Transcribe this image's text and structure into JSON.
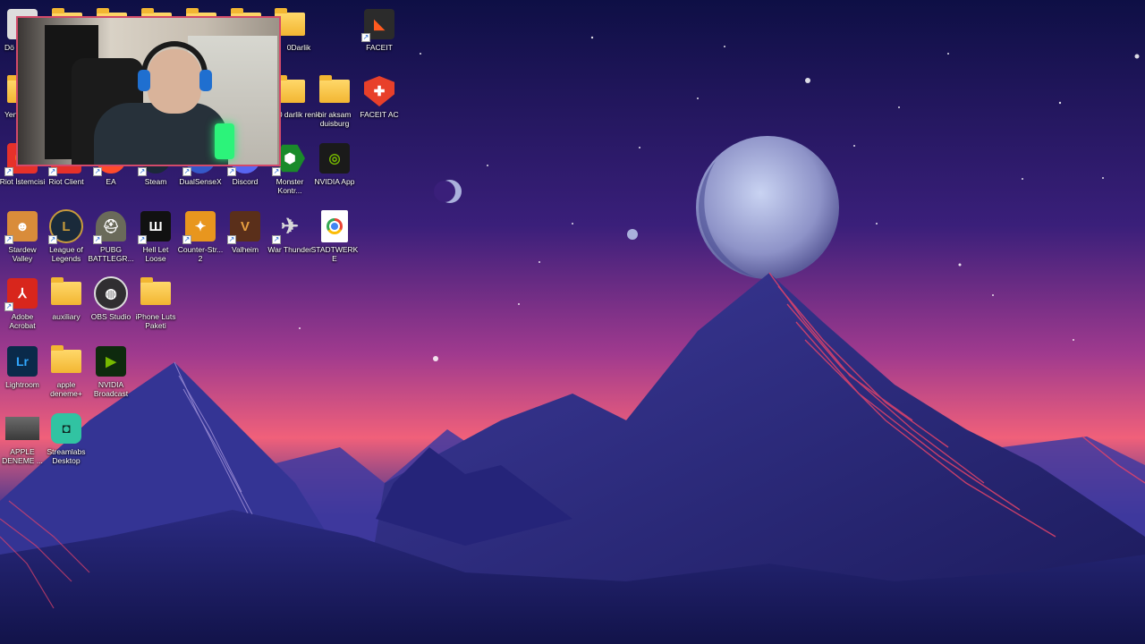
{
  "colors": {
    "sky_top": "#10114a",
    "sky_mid": "#5a2f8f",
    "sky_glow": "#f2577a",
    "mountain": "#2b2d7a",
    "mountain_dark": "#1b1c55",
    "ridge": "#e2436a"
  },
  "desktop": {
    "icons": [
      {
        "name": "icon-facet",
        "label": "FACEIT",
        "icon": "faceit-icon",
        "color": "#2b2b2b",
        "glyph": "◣"
      },
      {
        "name": "icon-0darlik",
        "label": "0Darlik",
        "icon": "folder-icon"
      },
      {
        "name": "icon-0darlik-renk",
        "label": "0 darlik renk",
        "icon": "folder-icon"
      },
      {
        "name": "icon-bir-aksam",
        "label": "bir aksam duisburg",
        "icon": "folder-icon"
      },
      {
        "name": "icon-faceit-ac",
        "label": "FACEIT AC",
        "icon": "faceit-ac-icon",
        "color": "#e8402a",
        "glyph": "✚"
      },
      {
        "name": "icon-do",
        "label": "Dö",
        "icon": "partial-icon"
      },
      {
        "name": "icon-yen",
        "label": "Yen",
        "icon": "folder-icon"
      },
      {
        "name": "icon-riot-istemcisi",
        "label": "Riot İstemcisi",
        "icon": "riot-icon",
        "color": "#e6312a",
        "glyph": "✊"
      },
      {
        "name": "icon-riot-client",
        "label": "Riot Client",
        "icon": "riot-icon",
        "color": "#e6312a",
        "glyph": "✊"
      },
      {
        "name": "icon-ea",
        "label": "EA",
        "icon": "ea-icon",
        "color": "#ff4b2b",
        "glyph": "EA"
      },
      {
        "name": "icon-steam",
        "label": "Steam",
        "icon": "steam-icon",
        "color": "#1b2838",
        "glyph": "◉"
      },
      {
        "name": "icon-dualsensex",
        "label": "DualSenseX",
        "icon": "dualsensex-icon",
        "color": "#3558c9",
        "glyph": "✕"
      },
      {
        "name": "icon-discord",
        "label": "Discord",
        "icon": "discord-icon",
        "color": "#5865f2",
        "glyph": "☺"
      },
      {
        "name": "icon-monster",
        "label": "Monster Kontr...",
        "icon": "monster-icon",
        "color": "#1a8a2a",
        "glyph": "⬢"
      },
      {
        "name": "icon-nvidia-app",
        "label": "NVIDIA App",
        "icon": "nvidia-icon",
        "color": "#76b900",
        "glyph": "◎"
      },
      {
        "name": "icon-stardew",
        "label": "Stardew Valley",
        "icon": "stardew-icon",
        "color": "#d98c3a",
        "glyph": "🐔"
      },
      {
        "name": "icon-lol",
        "label": "League of Legends",
        "icon": "lol-icon",
        "color": "#1a2a3a",
        "glyph": "L"
      },
      {
        "name": "icon-pubg",
        "label": "PUBG BATTLEGR...",
        "icon": "pubg-icon",
        "color": "#6a6a5a",
        "glyph": "⛑"
      },
      {
        "name": "icon-hll",
        "label": "Hell Let Loose",
        "icon": "hll-icon",
        "color": "#111111",
        "glyph": "Ш"
      },
      {
        "name": "icon-cs2",
        "label": "Counter-Str... 2",
        "icon": "cs2-icon",
        "color": "#e8961e",
        "glyph": "🔫"
      },
      {
        "name": "icon-valheim",
        "label": "Valheim",
        "icon": "valheim-icon",
        "color": "#5a2f1a",
        "glyph": "V"
      },
      {
        "name": "icon-war-thunder",
        "label": "War Thunder",
        "icon": "war-thunder-icon",
        "color": "#8a1a1a",
        "glyph": "✈"
      },
      {
        "name": "icon-stadtwerke",
        "label": "STADTWERKE",
        "icon": "chrome-icon",
        "color": "#ffffff",
        "glyph": "◎"
      },
      {
        "name": "icon-acrobat",
        "label": "Adobe Acrobat",
        "icon": "acrobat-icon",
        "color": "#d8261c",
        "glyph": "A"
      },
      {
        "name": "icon-auxiliary",
        "label": "auxiliary",
        "icon": "folder-icon"
      },
      {
        "name": "icon-obs",
        "label": "OBS Studio",
        "icon": "obs-icon",
        "color": "#302e31",
        "glyph": "◍"
      },
      {
        "name": "icon-iphone-luts",
        "label": "iPhone Luts Paketi",
        "icon": "folder-icon"
      },
      {
        "name": "icon-lightroom",
        "label": "Lightroom",
        "icon": "lightroom-icon",
        "color": "#0a2a4a",
        "glyph": "Lr"
      },
      {
        "name": "icon-apple-deneme",
        "label": "apple deneme+",
        "icon": "folder-icon"
      },
      {
        "name": "icon-nvidia-broadcast",
        "label": "NVIDIA Broadcast",
        "icon": "nvidia-broadcast-icon",
        "color": "#0e2a0e",
        "glyph": "▶"
      },
      {
        "name": "icon-apple-deneme-video",
        "label": "APPLE DENEME ...",
        "icon": "video-thumb-icon",
        "color": "#4a4a4a",
        "glyph": "▤"
      },
      {
        "name": "icon-streamlabs",
        "label": "Streamlabs Desktop",
        "icon": "streamlabs-icon",
        "color": "#31c3a2",
        "glyph": "◘"
      }
    ]
  }
}
